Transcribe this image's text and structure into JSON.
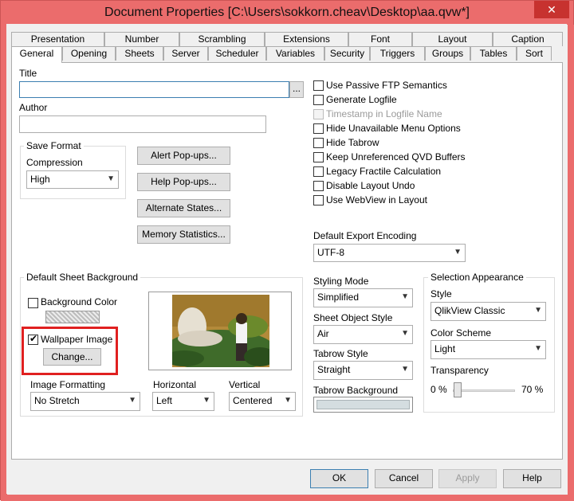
{
  "window": {
    "title": "Document Properties [C:\\Users\\sokkorn.cheav\\Desktop\\aa.qvw*]",
    "close_symbol": "✕"
  },
  "tabs_row1": [
    "Presentation",
    "Number",
    "Scrambling",
    "Extensions",
    "Font",
    "Layout",
    "Caption"
  ],
  "tabs_row2": [
    "General",
    "Opening",
    "Sheets",
    "Server",
    "Scheduler",
    "Variables",
    "Security",
    "Triggers",
    "Groups",
    "Tables",
    "Sort"
  ],
  "active_tab": "General",
  "general": {
    "title_label": "Title",
    "title_value": "",
    "browse_label": "...",
    "author_label": "Author",
    "author_value": "",
    "save_format": {
      "group_label": "Save Format",
      "compression_label": "Compression",
      "compression_value": "High"
    },
    "buttons": {
      "alert_popups": "Alert Pop-ups...",
      "help_popups": "Help Pop-ups...",
      "alternate_states": "Alternate States...",
      "memory_statistics": "Memory Statistics..."
    },
    "options": [
      {
        "label": "Use Passive FTP Semantics",
        "checked": false,
        "enabled": true
      },
      {
        "label": "Generate Logfile",
        "checked": false,
        "enabled": true
      },
      {
        "label": "Timestamp in Logfile Name",
        "checked": false,
        "enabled": false
      },
      {
        "label": "Hide Unavailable Menu Options",
        "checked": false,
        "enabled": true
      },
      {
        "label": "Hide Tabrow",
        "checked": false,
        "enabled": true
      },
      {
        "label": "Keep Unreferenced QVD Buffers",
        "checked": false,
        "enabled": true
      },
      {
        "label": "Legacy Fractile Calculation",
        "checked": false,
        "enabled": true
      },
      {
        "label": "Disable Layout Undo",
        "checked": false,
        "enabled": true
      },
      {
        "label": "Use WebView in Layout",
        "checked": false,
        "enabled": true
      }
    ],
    "export_encoding": {
      "label": "Default Export Encoding",
      "value": "UTF-8"
    },
    "sheet_background": {
      "group_label": "Default Sheet Background",
      "background_color_label": "Background Color",
      "background_color_checked": false,
      "wallpaper_label": "Wallpaper Image",
      "wallpaper_checked": true,
      "change_button": "Change...",
      "image_formatting_label": "Image Formatting",
      "image_formatting_value": "No Stretch",
      "horizontal_label": "Horizontal",
      "horizontal_value": "Left",
      "vertical_label": "Vertical",
      "vertical_value": "Centered"
    },
    "styling": {
      "styling_mode_label": "Styling Mode",
      "styling_mode_value": "Simplified",
      "sheet_object_style_label": "Sheet Object Style",
      "sheet_object_style_value": "Air",
      "tabrow_style_label": "Tabrow Style",
      "tabrow_style_value": "Straight",
      "tabrow_background_label": "Tabrow Background"
    },
    "selection": {
      "group_label": "Selection Appearance",
      "style_label": "Style",
      "style_value": "QlikView Classic",
      "color_scheme_label": "Color Scheme",
      "color_scheme_value": "Light",
      "transparency_label": "Transparency",
      "min_label": "0 %",
      "max_label": "70 %",
      "transparency_value": 0
    }
  },
  "footer": {
    "ok": "OK",
    "cancel": "Cancel",
    "apply": "Apply",
    "help": "Help"
  },
  "colors": {
    "frame": "#eb6c6c",
    "highlight": "#e02020",
    "tabrow_background": "#d4dde0"
  }
}
